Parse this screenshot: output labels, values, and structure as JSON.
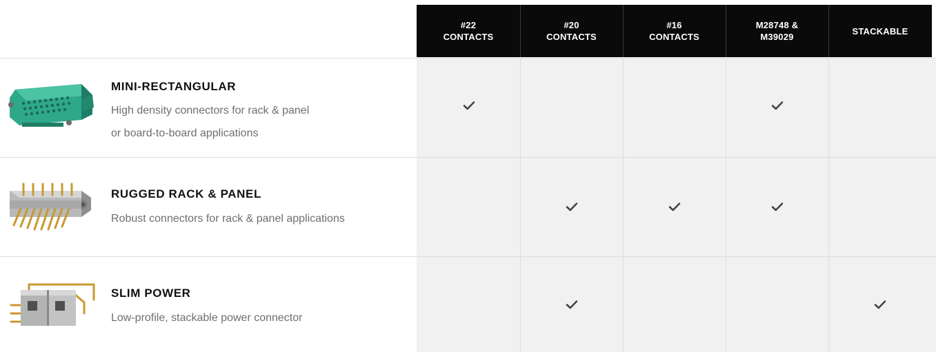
{
  "columns": [
    {
      "label": "#22\nCONTACTS"
    },
    {
      "label": "#20\nCONTACTS"
    },
    {
      "label": "#16\nCONTACTS"
    },
    {
      "label": "M28748 &\nM39029"
    },
    {
      "label": "STACKABLE"
    }
  ],
  "rows": [
    {
      "name": "MINI-RECTANGULAR",
      "description": "High density connectors for rack & panel\nor board-to-board applications",
      "image": "mini-rectangular-connector-image",
      "checks": [
        true,
        false,
        false,
        true,
        false
      ]
    },
    {
      "name": "RUGGED RACK & PANEL",
      "description": "Robust connectors for rack & panel applications",
      "image": "rugged-rack-panel-connector-image",
      "checks": [
        false,
        true,
        true,
        true,
        false
      ]
    },
    {
      "name": "SLIM POWER",
      "description": "Low-profile, stackable power connector",
      "image": "slim-power-connector-image",
      "checks": [
        false,
        true,
        false,
        false,
        true
      ]
    }
  ],
  "colors": {
    "header_bg": "#0a0a0a",
    "header_text": "#ffffff",
    "column_bg": "#f1f1f1",
    "check": "#444444",
    "mini_rect_body": "#2fa88a"
  },
  "icons": {
    "check": "check-icon"
  }
}
